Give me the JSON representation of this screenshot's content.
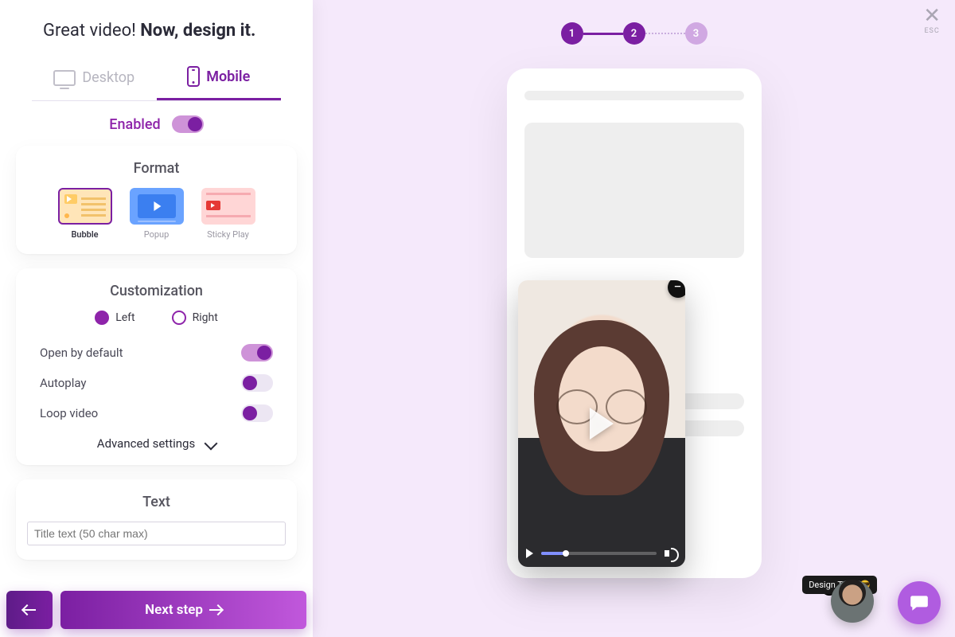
{
  "header": {
    "normal": "Great video! ",
    "bold": "Now, design it."
  },
  "tabs": {
    "desktop": "Desktop",
    "mobile": "Mobile",
    "active": "mobile"
  },
  "enabled": {
    "label": "Enabled",
    "value": true
  },
  "format": {
    "title": "Format",
    "options": [
      {
        "id": "bubble",
        "label": "Bubble",
        "selected": true
      },
      {
        "id": "popup",
        "label": "Popup",
        "selected": false
      },
      {
        "id": "sticky",
        "label": "Sticky Play",
        "selected": false
      }
    ]
  },
  "customization": {
    "title": "Customization",
    "position": {
      "left_label": "Left",
      "right_label": "Right",
      "selected": "left"
    },
    "open_default": {
      "label": "Open by default",
      "value": true
    },
    "autoplay": {
      "label": "Autoplay",
      "value": false
    },
    "loop": {
      "label": "Loop video",
      "value": false
    },
    "advanced_label": "Advanced settings"
  },
  "text": {
    "title": "Text",
    "title_input": {
      "value": "",
      "placeholder": "Title text (50 char max)"
    }
  },
  "buttons": {
    "next": "Next step"
  },
  "stepper": {
    "steps": [
      "1",
      "2",
      "3"
    ],
    "current": 2
  },
  "esc": {
    "label": "ESC"
  },
  "preview": {
    "video": {
      "progress_pct": 22
    },
    "close_glyph": "−"
  },
  "tips": {
    "label": "Design Tips!",
    "emoji": "😎",
    "close": "✕"
  }
}
